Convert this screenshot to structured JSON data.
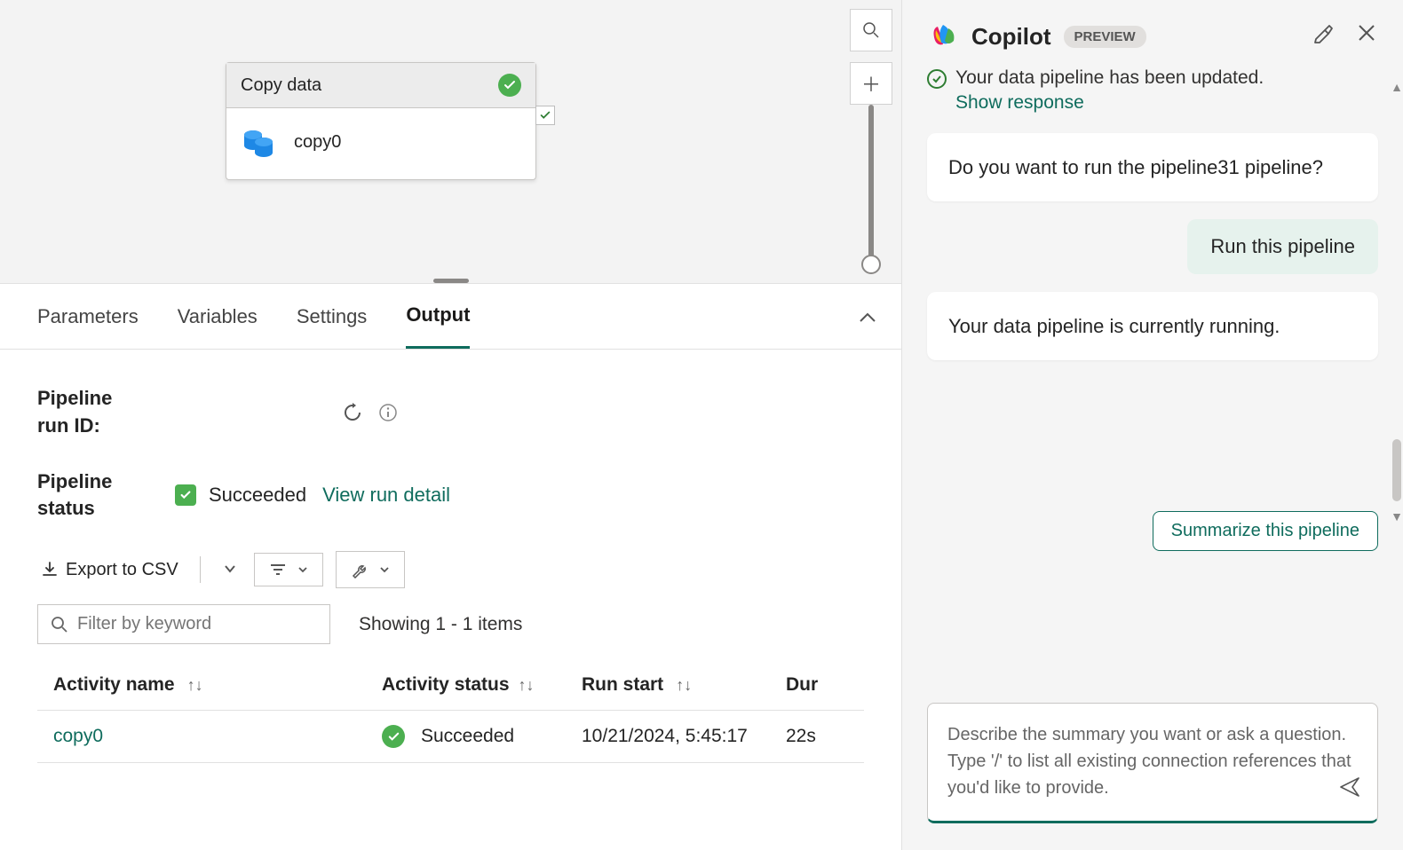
{
  "canvas": {
    "activity": {
      "title": "Copy data",
      "name": "copy0"
    }
  },
  "tabs": {
    "parameters": "Parameters",
    "variables": "Variables",
    "settings": "Settings",
    "output": "Output",
    "active": "output"
  },
  "output": {
    "runIdLabel": "Pipeline run ID:",
    "statusLabel": "Pipeline status",
    "statusValue": "Succeeded",
    "viewRunLink": "View run detail",
    "exportLabel": "Export to CSV",
    "filterPlaceholder": "Filter by keyword",
    "showingText": "Showing 1 - 1 items",
    "columns": {
      "activityName": "Activity name",
      "activityStatus": "Activity status",
      "runStart": "Run start",
      "duration": "Dur"
    },
    "rows": [
      {
        "name": "copy0",
        "status": "Succeeded",
        "runStart": "10/21/2024, 5:45:17",
        "duration": "22s"
      }
    ]
  },
  "copilot": {
    "title": "Copilot",
    "badge": "PREVIEW",
    "truncatedMessage": "Your data pipeline has been updated.",
    "showResponse": "Show response",
    "msg1": "Do you want to run the pipeline31 pipeline?",
    "userMsg": "Run this pipeline",
    "msg2": "Your data pipeline is currently running.",
    "suggestion": "Summarize this pipeline",
    "placeholder": "Describe the summary you want or ask a question.\nType '/' to list all existing connection references that you'd like to provide."
  }
}
